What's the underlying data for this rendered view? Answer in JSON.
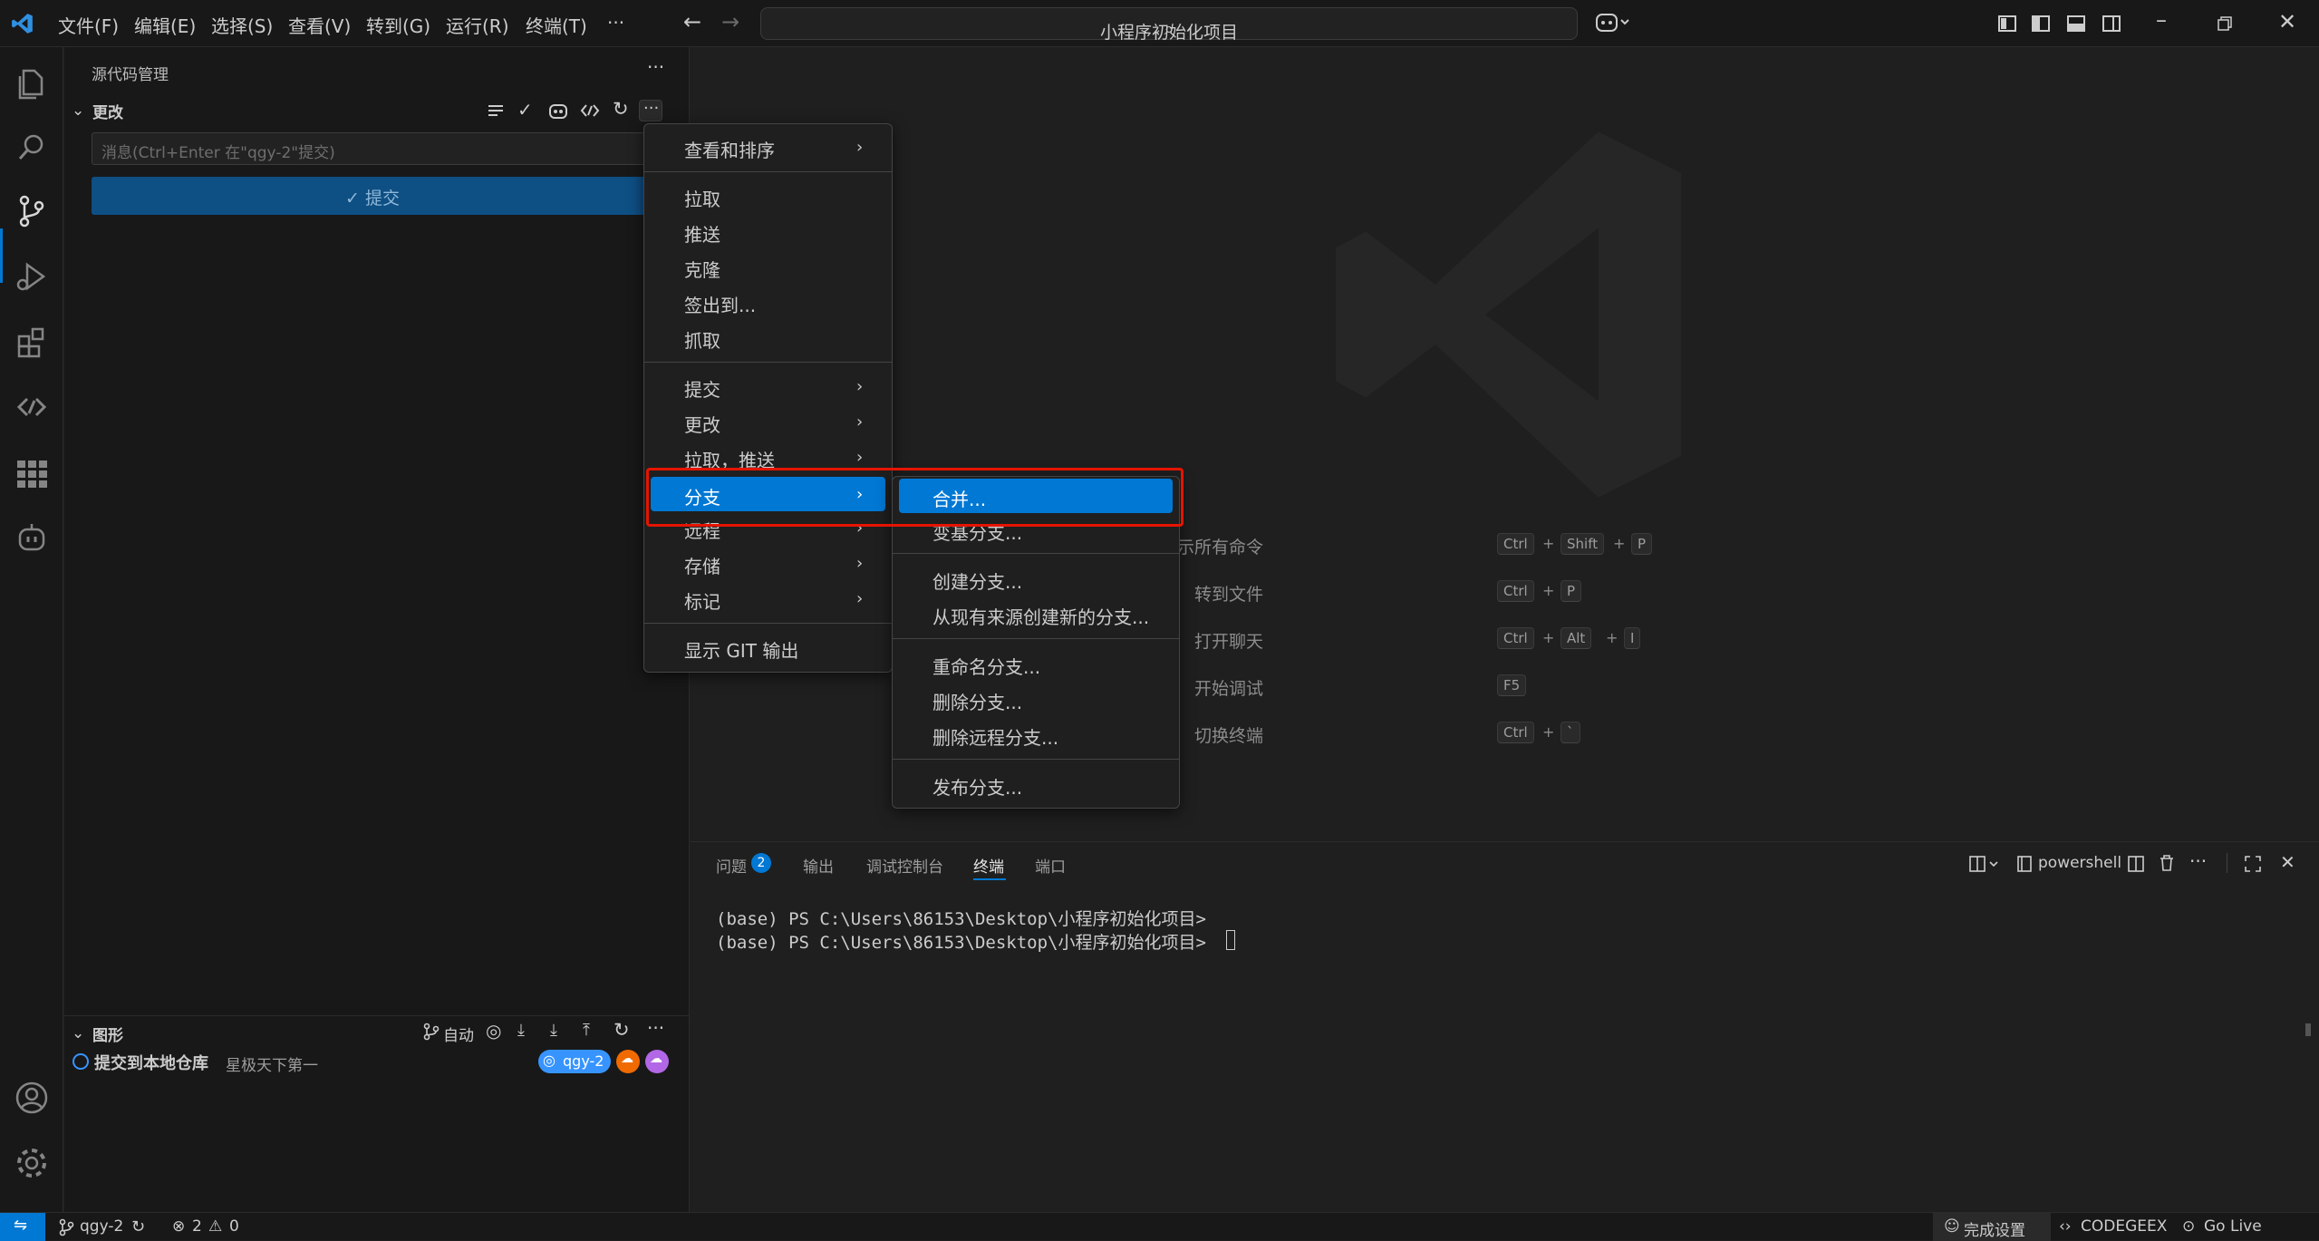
{
  "titlebar": {
    "menus": [
      "文件(F)",
      "编辑(E)",
      "选择(S)",
      "查看(V)",
      "转到(G)",
      "运行(R)",
      "终端(T)",
      "···"
    ],
    "search_text": "小程序初始化项目"
  },
  "sidebar": {
    "header": "源代码管理",
    "changes_section": "更改",
    "commit_placeholder": "消息(Ctrl+Enter 在\"qgy-2\"提交)",
    "commit_button": "✓ 提交",
    "graph_section": "图形",
    "graph_auto": "自动",
    "graph_item_title": "提交到本地仓库",
    "graph_item_author": "星极天下第一",
    "branch_badge": "qgy-2"
  },
  "context_menu": {
    "items": [
      "查看和排序",
      "拉取",
      "推送",
      "克隆",
      "签出到...",
      "抓取",
      "提交",
      "更改",
      "拉取，推送",
      "分支",
      "远程",
      "存储",
      "标记",
      "显示 GIT 输出"
    ]
  },
  "submenu": {
    "items": [
      "合并...",
      "变基分支...",
      "创建分支...",
      "从现有来源创建新的分支...",
      "重命名分支...",
      "删除分支...",
      "删除远程分支...",
      "发布分支..."
    ]
  },
  "editor": {
    "shortcuts": [
      {
        "label": "显示所有命令",
        "keys": [
          "Ctrl",
          "Shift",
          "P"
        ]
      },
      {
        "label": "转到文件",
        "keys": [
          "Ctrl",
          "P"
        ]
      },
      {
        "label": "打开聊天",
        "keys": [
          "Ctrl",
          "Alt",
          "I"
        ]
      },
      {
        "label": "开始调试",
        "keys": [
          "F5"
        ]
      },
      {
        "label": "切换终端",
        "keys": [
          "Ctrl",
          "`"
        ]
      }
    ]
  },
  "panel": {
    "tabs": [
      "问题",
      "输出",
      "调试控制台",
      "终端",
      "端口"
    ],
    "problems_count": "2",
    "shell": "powershell",
    "terminal_lines": [
      "(base) PS C:\\Users\\86153\\Desktop\\小程序初始化项目>",
      "(base) PS C:\\Users\\86153\\Desktop\\小程序初始化项目>"
    ]
  },
  "statusbar": {
    "branch": "qgy-2",
    "errors": "2",
    "warnings": "0",
    "setup": "完成设置",
    "codegeex": "CODEGEEX",
    "golive": "Go Live"
  },
  "colors": {
    "accent": "#0078d4",
    "highlight_box": "#e51400"
  }
}
